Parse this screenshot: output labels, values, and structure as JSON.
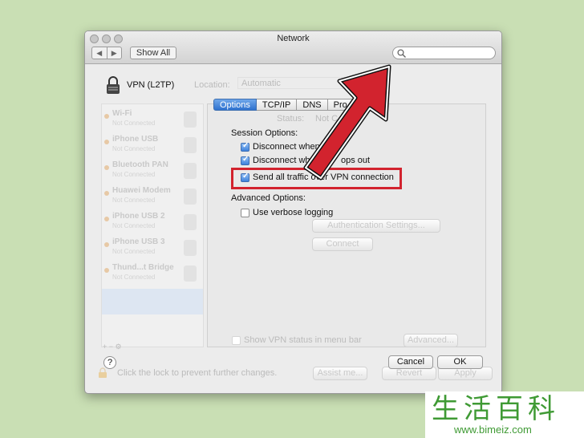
{
  "window": {
    "title": "Network",
    "nav_back": "◀",
    "nav_forward": "▶",
    "show_all": "Show All",
    "search_icon": "magnifier-icon"
  },
  "vpn": {
    "name": "VPN (L2TP)",
    "location_label": "Location:",
    "location_value": "Automatic"
  },
  "sidebar": {
    "items": [
      {
        "name": "Wi-Fi",
        "status": "Not Connected",
        "icon": "wifi-icon"
      },
      {
        "name": "iPhone USB",
        "status": "Not Connected",
        "icon": "phone-icon"
      },
      {
        "name": "Bluetooth PAN",
        "status": "Not Connected",
        "icon": "bluetooth-icon"
      },
      {
        "name": "Huawei Modem",
        "status": "Not Connected",
        "icon": "phone-handset-icon"
      },
      {
        "name": "iPhone USB 2",
        "status": "Not Connected",
        "icon": "phone-icon"
      },
      {
        "name": "iPhone USB 3",
        "status": "Not Connected",
        "icon": "phone-icon"
      },
      {
        "name": "Thund...t Bridge",
        "status": "Not Connected",
        "icon": "bridge-icon"
      }
    ],
    "add_remove": "+ − ⚙"
  },
  "background": {
    "status_label": "Status:",
    "status_value": "Not C",
    "auth_button": "Authentication Settings...",
    "connect_button": "Connect",
    "show_vpn_status": "Show VPN status in menu bar",
    "advanced_button": "Advanced...",
    "lock_text": "Click the lock to prevent further changes.",
    "assist_button": "Assist me...",
    "revert_button": "Revert",
    "apply_button": "Apply"
  },
  "tabs": [
    {
      "label": "Options",
      "selected": true
    },
    {
      "label": "TCP/IP",
      "selected": false
    },
    {
      "label": "DNS",
      "selected": false
    },
    {
      "label": "Pro",
      "selected": false
    }
  ],
  "sheet": {
    "session_options_label": "Session Options:",
    "session_options": [
      {
        "label": "Disconnect when s",
        "checked": true
      },
      {
        "label": "Disconnect whe",
        "tail": "ops out",
        "checked": true
      },
      {
        "label": "Send all traffic over VPN connection",
        "checked": true
      }
    ],
    "advanced_options_label": "Advanced Options:",
    "advanced_options": [
      {
        "label": "Use verbose logging",
        "checked": false
      }
    ],
    "help": "?",
    "cancel": "Cancel",
    "ok": "OK"
  },
  "colors": {
    "background": "#c9dfb4",
    "accent": "#3f82dc",
    "arrow": "#d2232e"
  },
  "watermark": {
    "chars": "生活百科",
    "url": "www.bimeiz.com"
  }
}
